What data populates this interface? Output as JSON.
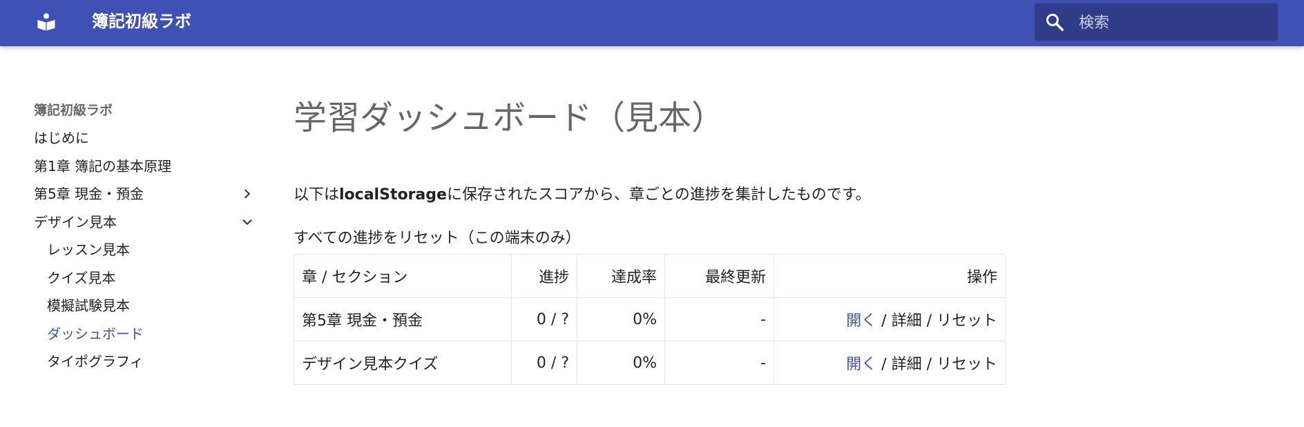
{
  "header": {
    "site_title": "簿記初級ラボ",
    "logo_icon": "book-reader-icon",
    "search_placeholder": "検索",
    "search_icon": "search-icon",
    "colors": {
      "primary": "#3f51b5",
      "accent": "#3f51b5"
    }
  },
  "sidebar": {
    "title": "簿記初級ラボ",
    "items": [
      {
        "label": "はじめに",
        "level": 0
      },
      {
        "label": "第1章 簿記の基本原理",
        "level": 0
      },
      {
        "label": "第5章 現金・預金",
        "level": 0,
        "toggle": "chevron-right-icon"
      },
      {
        "label": "デザイン見本",
        "level": 0,
        "toggle": "chevron-down-icon",
        "expanded": true
      },
      {
        "label": "レッスン見本",
        "level": 1
      },
      {
        "label": "クイズ見本",
        "level": 1
      },
      {
        "label": "模擬試験見本",
        "level": 1
      },
      {
        "label": "ダッシュボード",
        "level": 1,
        "active": true
      },
      {
        "label": "タイポグラフィ",
        "level": 1
      }
    ]
  },
  "main": {
    "title": "学習ダッシュボード（見本）",
    "intro_before": "以下は",
    "intro_bold": "localStorage",
    "intro_after": "に保存されたスコアから、章ごとの進捗を集計したものです。",
    "reset_all": "すべての進捗をリセット（この端末のみ）",
    "table": {
      "headers": [
        "章 / セクション",
        "進捗",
        "達成率",
        "最終更新",
        "操作"
      ],
      "rows": [
        {
          "section": "第5章 現金・預金",
          "progress": "0 / ?",
          "rate": "0%",
          "updated": "-",
          "open": "開く",
          "sep1": " / ",
          "detail": "詳細",
          "sep2": " / ",
          "reset": "リセット"
        },
        {
          "section": "デザイン見本クイズ",
          "progress": "0 / ?",
          "rate": "0%",
          "updated": "-",
          "open": "開く",
          "sep1": " / ",
          "detail": "詳細",
          "sep2": " / ",
          "reset": "リセット"
        }
      ]
    }
  }
}
